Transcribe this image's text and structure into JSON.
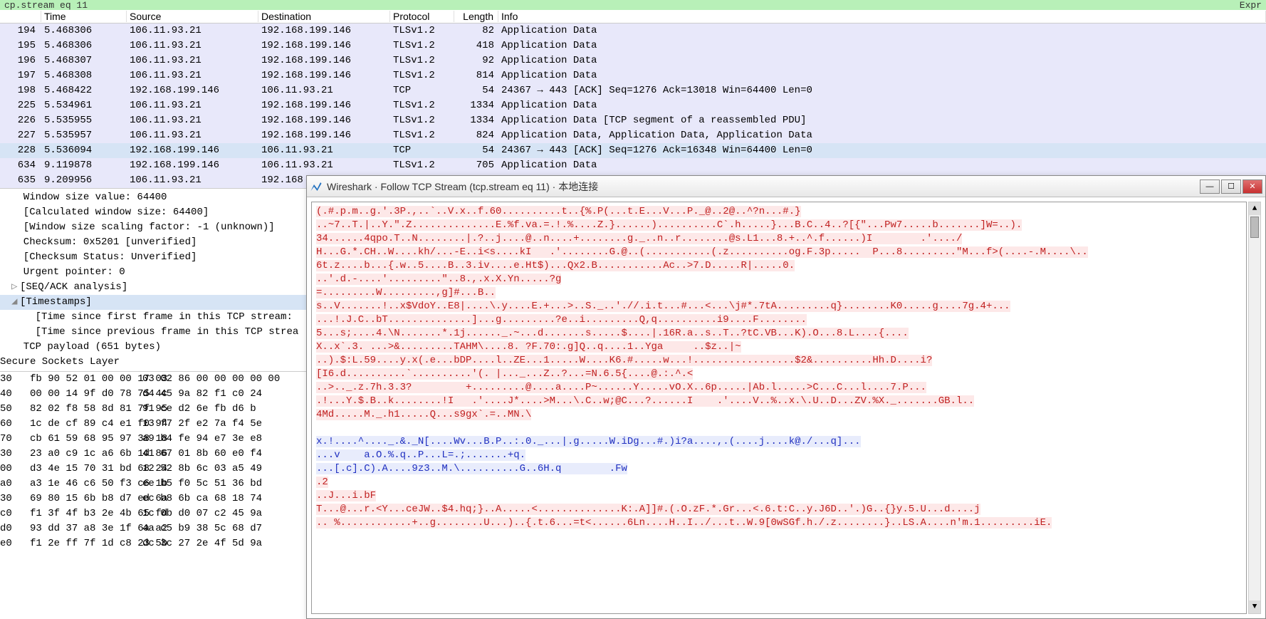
{
  "filter_text": "cp.stream eq 11",
  "filter_right": "Expr",
  "columns": {
    "no": "",
    "time": "Time",
    "src": "Source",
    "dst": "Destination",
    "proto": "Protocol",
    "len": "Length",
    "info": "Info"
  },
  "packets": [
    {
      "no": "194",
      "time": "5.468306",
      "src": "106.11.93.21",
      "dst": "192.168.199.146",
      "proto": "TLSv1.2",
      "len": "82",
      "info": "Application Data",
      "sel": false
    },
    {
      "no": "195",
      "time": "5.468306",
      "src": "106.11.93.21",
      "dst": "192.168.199.146",
      "proto": "TLSv1.2",
      "len": "418",
      "info": "Application Data",
      "sel": false
    },
    {
      "no": "196",
      "time": "5.468307",
      "src": "106.11.93.21",
      "dst": "192.168.199.146",
      "proto": "TLSv1.2",
      "len": "92",
      "info": "Application Data",
      "sel": false
    },
    {
      "no": "197",
      "time": "5.468308",
      "src": "106.11.93.21",
      "dst": "192.168.199.146",
      "proto": "TLSv1.2",
      "len": "814",
      "info": "Application Data",
      "sel": false
    },
    {
      "no": "198",
      "time": "5.468422",
      "src": "192.168.199.146",
      "dst": "106.11.93.21",
      "proto": "TCP",
      "len": "54",
      "info": "24367 → 443 [ACK] Seq=1276 Ack=13018 Win=64400 Len=0",
      "sel": false
    },
    {
      "no": "225",
      "time": "5.534961",
      "src": "106.11.93.21",
      "dst": "192.168.199.146",
      "proto": "TLSv1.2",
      "len": "1334",
      "info": "Application Data",
      "sel": false
    },
    {
      "no": "226",
      "time": "5.535955",
      "src": "106.11.93.21",
      "dst": "192.168.199.146",
      "proto": "TLSv1.2",
      "len": "1334",
      "info": "Application Data [TCP segment of a reassembled PDU]",
      "sel": false
    },
    {
      "no": "227",
      "time": "5.535957",
      "src": "106.11.93.21",
      "dst": "192.168.199.146",
      "proto": "TLSv1.2",
      "len": "824",
      "info": "Application Data, Application Data, Application Data",
      "sel": false
    },
    {
      "no": "228",
      "time": "5.536094",
      "src": "192.168.199.146",
      "dst": "106.11.93.21",
      "proto": "TCP",
      "len": "54",
      "info": "24367 → 443 [ACK] Seq=1276 Ack=16348 Win=64400 Len=0",
      "sel": true
    },
    {
      "no": "634",
      "time": "9.119878",
      "src": "192.168.199.146",
      "dst": "106.11.93.21",
      "proto": "TLSv1.2",
      "len": "705",
      "info": "Application Data",
      "sel": false
    },
    {
      "no": "635",
      "time": "9.209956",
      "src": "106.11.93.21",
      "dst": "192.168",
      "proto": "",
      "len": "",
      "info": "",
      "sel": false
    }
  ],
  "details": [
    {
      "text": "Window size value: 64400",
      "indent": 1
    },
    {
      "text": "[Calculated window size: 64400]",
      "indent": 1
    },
    {
      "text": "[Window size scaling factor: -1 (unknown)]",
      "indent": 1
    },
    {
      "text": "Checksum: 0x5201 [unverified]",
      "indent": 1
    },
    {
      "text": "[Checksum Status: Unverified]",
      "indent": 1
    },
    {
      "text": "Urgent pointer: 0",
      "indent": 1
    },
    {
      "text": "[SEQ/ACK analysis]",
      "indent": 1,
      "tri": "▷"
    },
    {
      "text": "[Timestamps]",
      "indent": 1,
      "tri": "◢",
      "sel": true
    },
    {
      "text": "[Time since first frame in this TCP stream:",
      "indent": 2
    },
    {
      "text": "[Time since previous frame in this TCP strea",
      "indent": 2
    },
    {
      "text": "TCP payload (651 bytes)",
      "indent": 1
    },
    {
      "text": "Secure Sockets Layer",
      "indent": 0
    }
  ],
  "hex": [
    {
      "o": "30",
      "b1": "fb 90 52 01 00 00 17 03",
      "b2": "03 02 86 00 00 00 00 00"
    },
    {
      "o": "40",
      "b1": "00 00 14 9f d0 78 75 4c",
      "b2": "d4 45 9a 82 f1 c0 24"
    },
    {
      "o": "50",
      "b1": "82 02 f8 58 8d 81 7f 95",
      "b2": "91 ce d2 6e fb d6 b"
    },
    {
      "o": "60",
      "b1": "1c de cf 89 c4 e1 f0 94",
      "b2": "13 f7 2f e2 7a f4 5e"
    },
    {
      "o": "70",
      "b1": "cb 61 59 68 95 97 38 18",
      "b2": "a9 b4 fe 94 e7 3e e8"
    },
    {
      "o": "30",
      "b1": "23 a0 c9 1c a6 6b 1d 86",
      "b2": "41 67 01 8b 60 e0 f4"
    },
    {
      "o": "00",
      "b1": "d3 4e 15 70 31 bd 68 24",
      "b2": "12 52 8b 6c 03 a5 49"
    },
    {
      "o": "a0",
      "b1": "a3 1e 46 c6 50 f3 c6 1b",
      "b2": "ee b5 f0 5c 51 36 bd"
    },
    {
      "o": "30",
      "b1": "69 80 15 6b b8 d7 ed 6a",
      "b2": "ec b8 6b ca 68 18 74"
    },
    {
      "o": "c0",
      "b1": "f1 3f 4f b3 2e 4b 65 fd",
      "b2": "1c 0b d0 07 c2 45 9a"
    },
    {
      "o": "d0",
      "b1": "93 dd 37 a8 3e 1f 6a a2",
      "b2": "4a c5 b9 38 5c 68 d7"
    },
    {
      "o": "e0",
      "b1": "f1 2e ff 7f 1d c8 23 5b",
      "b2": "dc 3c 27 2e 4f 5d 9a"
    }
  ],
  "dialog": {
    "title": "Wireshark · Follow TCP Stream (tcp.stream eq 11) · 本地连接",
    "segments": [
      {
        "cls": "red",
        "text": "(.#.p.m..g.'.3P.,..`..V.x..f.60..........t..{%.P(...t.E...V...P._@..2@..^?n...#.}\n..~7..T.|..Y.\".Z..............E.%f.va.=.!.%....Z.}......)..........C`.h.....}...B.C..4..?[{\"...Pw7.....b.......]W=..).\n34......4qpo.T..N........|.?..j....@..n....+........g._..n..r........@s.L1...8.+..^.f......)I        .'..../\nH...G.*.CH..W....kh/...-E..i<s....kI   .'........G.@..(...........(.z..........og.F.3p.....  P...8.........\"M...f>(....-.M....\\..\n6t.z....b...{.w..5....B..3.iv....e.Ht$)...Qx2.B...........Ac..>7.D.....R|.....0.\n..'.d.-....'.........\"..8.,.x.X.Yn.....?g\n=.........W.........,g]#...B..\ns..V.......!..x$VdoY..E8|....\\.y....E.+...>..S._..'.//.i.t...#...<...\\j#*.7tA.........q}........K0.....g....7g.4+...\n...!.J.C..bT..............]...g.........?e..i.........Q,q..........i9....F........\n5...s;....4.\\N.......*.1j......_.~...d.......s.....$....|.16R.a..s..T..?tC.VB...K).O...8.L....{....\nX..x`.3. ...>&.........TAHM\\....8. ?F.70:.g]Q..q....1..Yga     ..$z..|~\n..).$:L.59....y.x(.e...bDP....l..ZE...1.....W....K6.#.....w...!.................$2&..........Hh.D....i?\n[I6.d..........`..........'(. |..._...Z..?...=N.6.5{....@.:.^.<\n..>.._.z.7h.3.3?         +.........@....a....P~......Y.....vO.X..6p.....|Ab.l.....>C...C...l....7.P...\n.!...Y.$.B..k........!I   .'....J*....>M...\\.C..w;@C...?......I    .'....V..%..x.\\.U..D...ZV.%X._.......GB.l..\n4Md.....M._.h1.....Q...s9gx`.=..MN.\\"
      },
      {
        "cls": "blue",
        "text": "\n\nx.!....^...._.&._N[....Wv...B.P..:.0._...|.g.....W.iDg...#.)i?a....,.(....j....k@./...q]...\n...v    a.O.%.q..P...L=.;.......+q.\n...[.c].C).A....9z3..M.\\..........G..6H.q        .Fw"
      },
      {
        "cls": "red",
        "text": "\n.2\n..J...i.bF\nT...@...r.<Y...ceJW..$4.hq;}..A.....<..............K:.A]]#.(.O.zF.*.Gr...<.6.t:C..y.J6D..'.)G..{}y.5.U...d....j\n.. %............+..g........U...)..{.t.6...=t<......6Ln....H..I../...t..W.9[0wSGf.h./.z........}..LS.A....n'm.1.........iE."
      }
    ]
  }
}
